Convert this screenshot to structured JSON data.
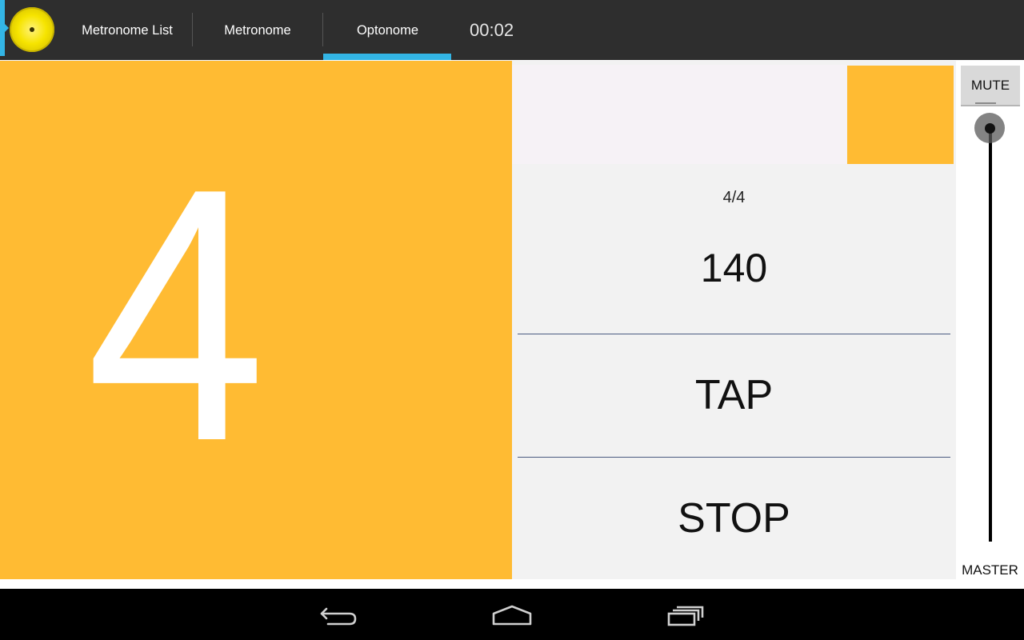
{
  "tabs": [
    {
      "label": "Metronome List",
      "selected": false
    },
    {
      "label": "Metronome",
      "selected": false
    },
    {
      "label": "Optonome",
      "selected": true
    }
  ],
  "timer": "00:02",
  "beat": {
    "current": "4"
  },
  "controls": {
    "time_signature": "4/4",
    "tempo": "140",
    "tap_label": "TAP",
    "stop_label": "STOP"
  },
  "master": {
    "mute_label": "MUTE",
    "label": "MASTER",
    "volume_level": 1.0
  },
  "icons": {
    "app_logo": "cymbal-logo-icon",
    "nav_back": "back-arrow-icon",
    "nav_home": "home-icon",
    "nav_recent": "recent-apps-icon"
  },
  "colors": {
    "accent": "#33b5e5",
    "beat_color": "#ffbb33",
    "action_bar": "#2e2e2e"
  }
}
